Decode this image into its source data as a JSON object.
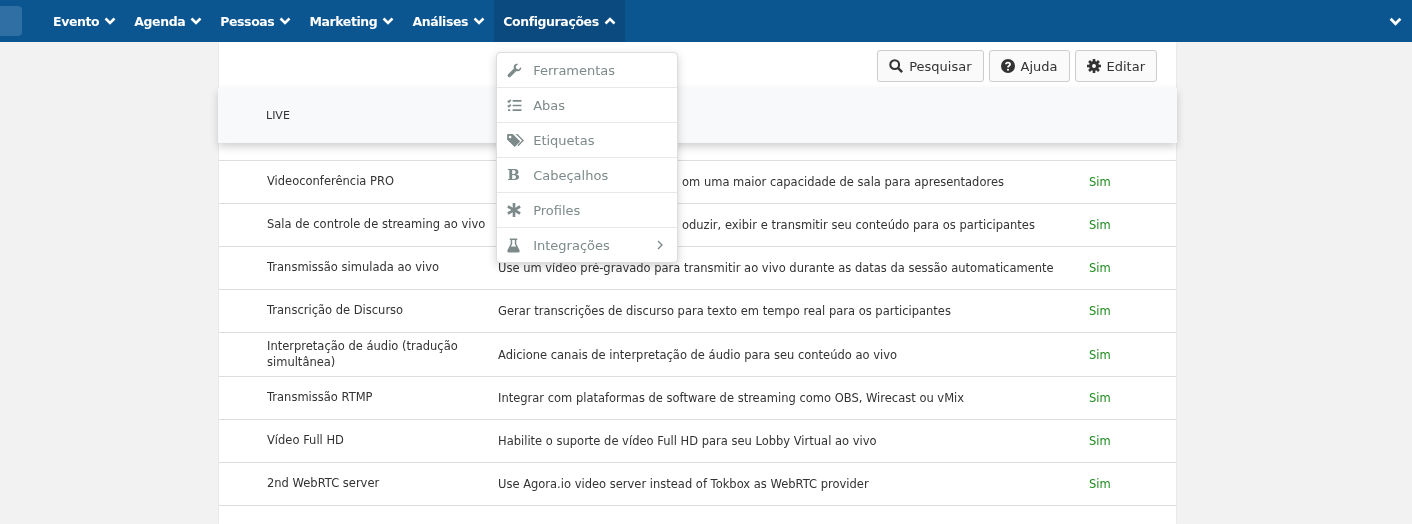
{
  "nav": {
    "items": [
      {
        "label": "Evento",
        "expanded": false
      },
      {
        "label": "Agenda",
        "expanded": false
      },
      {
        "label": "Pessoas",
        "expanded": false
      },
      {
        "label": "Marketing",
        "expanded": false
      },
      {
        "label": "Análises",
        "expanded": false
      },
      {
        "label": "Configurações",
        "expanded": true
      }
    ],
    "user_menu": {
      "expanded": false
    }
  },
  "dropdown": {
    "items": [
      {
        "label": "Ferramentas",
        "submenu": false
      },
      {
        "label": "Abas",
        "submenu": false
      },
      {
        "label": "Etiquetas",
        "submenu": false
      },
      {
        "label": "Cabeçalhos",
        "glyph": "B",
        "submenu": false
      },
      {
        "label": "Profiles",
        "submenu": false
      },
      {
        "label": "Integrações",
        "submenu": true
      }
    ]
  },
  "toolbar": {
    "buttons": [
      {
        "label": "Pesquisar"
      },
      {
        "label": "Ajuda"
      },
      {
        "label": "Editar"
      }
    ]
  },
  "section": {
    "title": "LIVE"
  },
  "table": {
    "rows": [
      {
        "name": "Videoconferência PRO",
        "description": "om uma maior capacidade de sala para apresentadores",
        "covered": true,
        "value": "Sim"
      },
      {
        "name": "Sala de controle de streaming ao vivo",
        "description": "oduzir, exibir e transmitir seu conteúdo para os participantes",
        "covered": true,
        "value": "Sim"
      },
      {
        "name": "Transmissão simulada ao vivo",
        "description": "Use um vídeo pré-gravado para transmitir ao vivo durante as datas da sessão automaticamente",
        "covered": false,
        "value": "Sim"
      },
      {
        "name": "Transcrição de Discurso",
        "description": "Gerar transcrições de discurso para texto em tempo real para os participantes",
        "covered": false,
        "value": "Sim"
      },
      {
        "name": "Interpretação de áudio (tradução simultânea)",
        "description": "Adicione canais de interpretação de áudio para seu conteúdo ao vivo",
        "covered": false,
        "value": "Sim"
      },
      {
        "name": "Transmissão RTMP",
        "description": "Integrar com plataformas de software de streaming como OBS, Wirecast ou vMix",
        "covered": false,
        "value": "Sim"
      },
      {
        "name": "Vídeo Full HD",
        "description": "Habilite o suporte de vídeo Full HD para seu Lobby Virtual ao vivo",
        "covered": false,
        "value": "Sim"
      },
      {
        "name": "2nd WebRTC server",
        "description": "Use Agora.io video server instead of Tokbox as WebRTC provider",
        "covered": false,
        "value": "Sim"
      }
    ]
  }
}
